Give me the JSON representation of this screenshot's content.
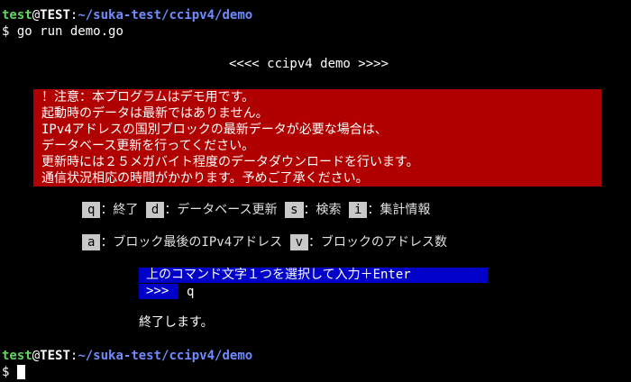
{
  "prompt1": {
    "user": "test",
    "at": "@",
    "host": "TEST",
    "colon": ":",
    "path": "~/suka-test/ccipv4/demo",
    "dollar": "$",
    "command": " go run demo.go"
  },
  "title": "<<<< ccipv4 demo >>>>",
  "notice": {
    "lines": [
      "！注意：本プログラムはデモ用です。",
      "起動時のデータは最新ではありません。",
      "IPv4アドレスの国別ブロックの最新データが必要な場合は、",
      "データベース更新を行ってください。",
      "更新時には２５メガバイト程度のデータダウンロードを行います。",
      "通信状況相応の時間がかかります。予めご了承ください。"
    ]
  },
  "menu": {
    "row1": [
      {
        "key": "q",
        "label": "：終了"
      },
      {
        "key": "d",
        "label": "：データベース更新"
      },
      {
        "key": "s",
        "label": "：検索"
      },
      {
        "key": "i",
        "label": "：集計情報"
      }
    ],
    "row2": [
      {
        "key": "a",
        "label": "：ブロック最後のIPv4アドレス"
      },
      {
        "key": "v",
        "label": "：ブロックのアドレス数"
      }
    ]
  },
  "hint": "上のコマンド文字１つを選択して入力＋Enter",
  "input": {
    "prompt": ">>>",
    "value": "q"
  },
  "exit_message": "終了します。",
  "prompt2": {
    "user": "test",
    "at": "@",
    "host": "TEST",
    "colon": ":",
    "path": "~/suka-test/ccipv4/demo",
    "dollar": "$"
  },
  "colors": {
    "background": "#000000",
    "notice_bg": "#b00000",
    "hint_bg": "#0000c8",
    "key_bg": "#c8c8c8",
    "prompt_user": "#5fd75f",
    "prompt_path": "#6f8cff"
  }
}
